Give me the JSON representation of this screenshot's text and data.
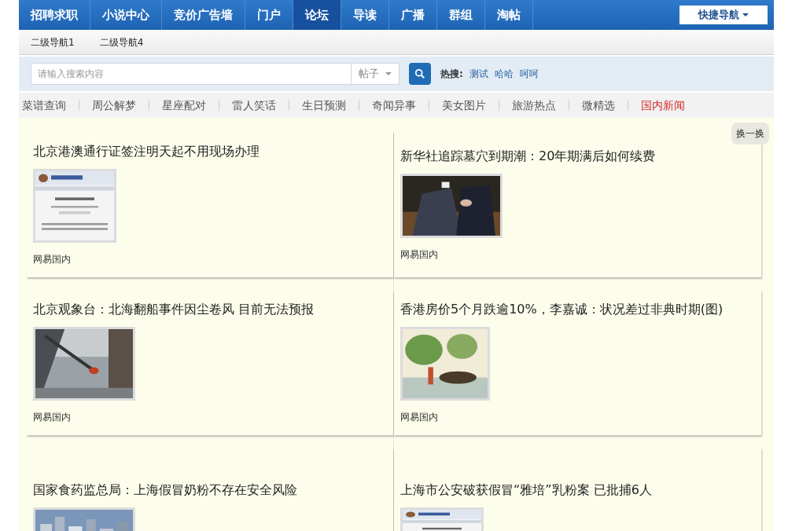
{
  "top_nav": {
    "items": [
      {
        "label": "招聘求职",
        "selected": false
      },
      {
        "label": "小说中心",
        "selected": false
      },
      {
        "label": "竞价广告墙",
        "selected": false
      },
      {
        "label": "门户",
        "selected": false
      },
      {
        "label": "论坛",
        "selected": true
      },
      {
        "label": "导读",
        "selected": false
      },
      {
        "label": "广播",
        "selected": false
      },
      {
        "label": "群组",
        "selected": false
      },
      {
        "label": "淘帖",
        "selected": false
      }
    ],
    "quick_nav": "快捷导航"
  },
  "sub_nav": [
    "二级导航1",
    "二级导航4"
  ],
  "search": {
    "placeholder": "请输入搜索内容",
    "scope": "帖子",
    "hot_label": "热搜:",
    "hot_terms": [
      "测试",
      "哈哈",
      "呵呵"
    ]
  },
  "categories": [
    {
      "label": "菜谱查询",
      "selected": false
    },
    {
      "label": "周公解梦",
      "selected": false
    },
    {
      "label": "星座配对",
      "selected": false
    },
    {
      "label": "雷人笑话",
      "selected": false
    },
    {
      "label": "生日预测",
      "selected": false
    },
    {
      "label": "奇闻异事",
      "selected": false
    },
    {
      "label": "美女图片",
      "selected": false
    },
    {
      "label": "旅游热点",
      "selected": false
    },
    {
      "label": "微精选",
      "selected": false
    },
    {
      "label": "国内新闻",
      "selected": true
    }
  ],
  "shuffle_button": "换一换",
  "news": [
    {
      "title": "北京港澳通行证签注明天起不用现场办理",
      "source": "网易国内"
    },
    {
      "title": "新华社追踪墓穴到期潮：20年期满后如何续费",
      "source": "网易国内"
    },
    {
      "title": "北京观象台：北海翻船事件因尘卷风 目前无法预报",
      "source": "网易国内"
    },
    {
      "title": "香港房价5个月跌逾10%，李嘉诚：状况差过非典时期(图)",
      "source": "网易国内"
    },
    {
      "title": "国家食药监总局：上海假冒奶粉不存在安全风险"
    },
    {
      "title": "上海市公安破获假冒“雅培”乳粉案 已批捕6人"
    }
  ]
}
